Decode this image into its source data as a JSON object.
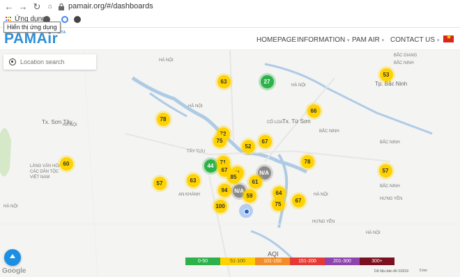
{
  "browser": {
    "url": "pamair.org/#/dashboards",
    "bookmark_label": "Ứng dụng",
    "tooltip": "Hiển thị ứng dụng"
  },
  "site": {
    "logo": "PAMAir",
    "menu": [
      "HOMEPAGE",
      "INFORMATION",
      "PAM AIR",
      "CONTACT US"
    ]
  },
  "map": {
    "search_placeholder": "Location search",
    "aqi_title": "AQI",
    "legend": [
      {
        "label": "0-50",
        "color": "#2db24a"
      },
      {
        "label": "51-100",
        "color": "#ffd200"
      },
      {
        "label": "101-150",
        "color": "#f28c28"
      },
      {
        "label": "151-200",
        "color": "#e53935"
      },
      {
        "label": "201-300",
        "color": "#8e44ad"
      },
      {
        "label": "300+",
        "color": "#7b1120"
      }
    ],
    "footer": "Dữ liệu bản đồ ©2019",
    "scale": "5 km",
    "google": "Google",
    "places": [
      "HÀ NỘI",
      "HÀ NỘI",
      "HÀ NỘI",
      "HÀ NỘI",
      "HÀ NỘI",
      "HÀ NỘI",
      "HÀ NỘI",
      "Tx. Sơn Tây",
      "Tx. Từ Sơn",
      "Tp. Bắc Ninh",
      "BẮC NINH",
      "BẮC NINH",
      "BẮC NINH",
      "BẮC NINH",
      "HƯNG YÊN",
      "HƯNG YÊN",
      "CỔ LOA",
      "TÂY TỰU",
      "AN KHÁNH",
      "LÀNG VĂN HÓA CÁC DÂN TỘC VIỆT NAM",
      "BẮC GIANG"
    ],
    "markers": [
      {
        "value": "63",
        "status": "yellow"
      },
      {
        "value": "27",
        "status": "green"
      },
      {
        "value": "53",
        "status": "yellow"
      },
      {
        "value": "66",
        "status": "yellow"
      },
      {
        "value": "78",
        "status": "yellow"
      },
      {
        "value": "72",
        "status": "yellow"
      },
      {
        "value": "75",
        "status": "yellow"
      },
      {
        "value": "52",
        "status": "yellow"
      },
      {
        "value": "67",
        "status": "yellow"
      },
      {
        "value": "60",
        "status": "yellow"
      },
      {
        "value": "44",
        "status": "green"
      },
      {
        "value": "71",
        "status": "yellow"
      },
      {
        "value": "67",
        "status": "yellow"
      },
      {
        "value": "N/A",
        "status": "grey"
      },
      {
        "value": "78",
        "status": "yellow"
      },
      {
        "value": "57",
        "status": "yellow"
      },
      {
        "value": "57",
        "status": "yellow"
      },
      {
        "value": "63",
        "status": "yellow"
      },
      {
        "value": "94",
        "status": "yellow"
      },
      {
        "value": "N/A",
        "status": "grey"
      },
      {
        "value": "59",
        "status": "yellow"
      },
      {
        "value": "64",
        "status": "yellow"
      },
      {
        "value": "75",
        "status": "yellow"
      },
      {
        "value": "67",
        "status": "yellow"
      },
      {
        "value": "100",
        "status": "yellow"
      },
      {
        "value": "61",
        "status": "yellow"
      },
      {
        "value": "71",
        "status": "yellow"
      },
      {
        "value": "85",
        "status": "yellow"
      }
    ]
  }
}
